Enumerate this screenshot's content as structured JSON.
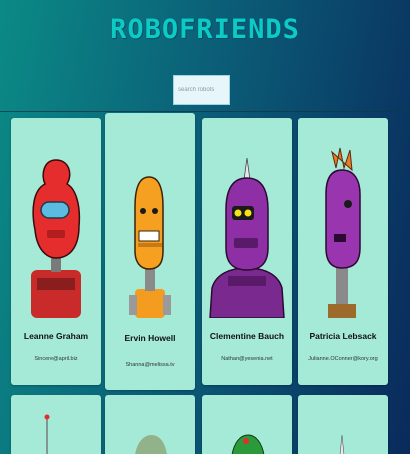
{
  "header": {
    "title": "ROBOFRIENDS"
  },
  "search": {
    "placeholder": "search robots",
    "value": ""
  },
  "robots": [
    {
      "name": "Leanne Graham",
      "email": "Sincere@april.biz"
    },
    {
      "name": "Ervin Howell",
      "email": "Shanna@melissa.tv"
    },
    {
      "name": "Clementine Bauch",
      "email": "Nathan@yesenia.net"
    },
    {
      "name": "Patricia Lebsack",
      "email": "Julianne.OConner@kory.org"
    }
  ],
  "colors": {
    "card_background": "#a5ead7",
    "title": "#0ccac4"
  }
}
